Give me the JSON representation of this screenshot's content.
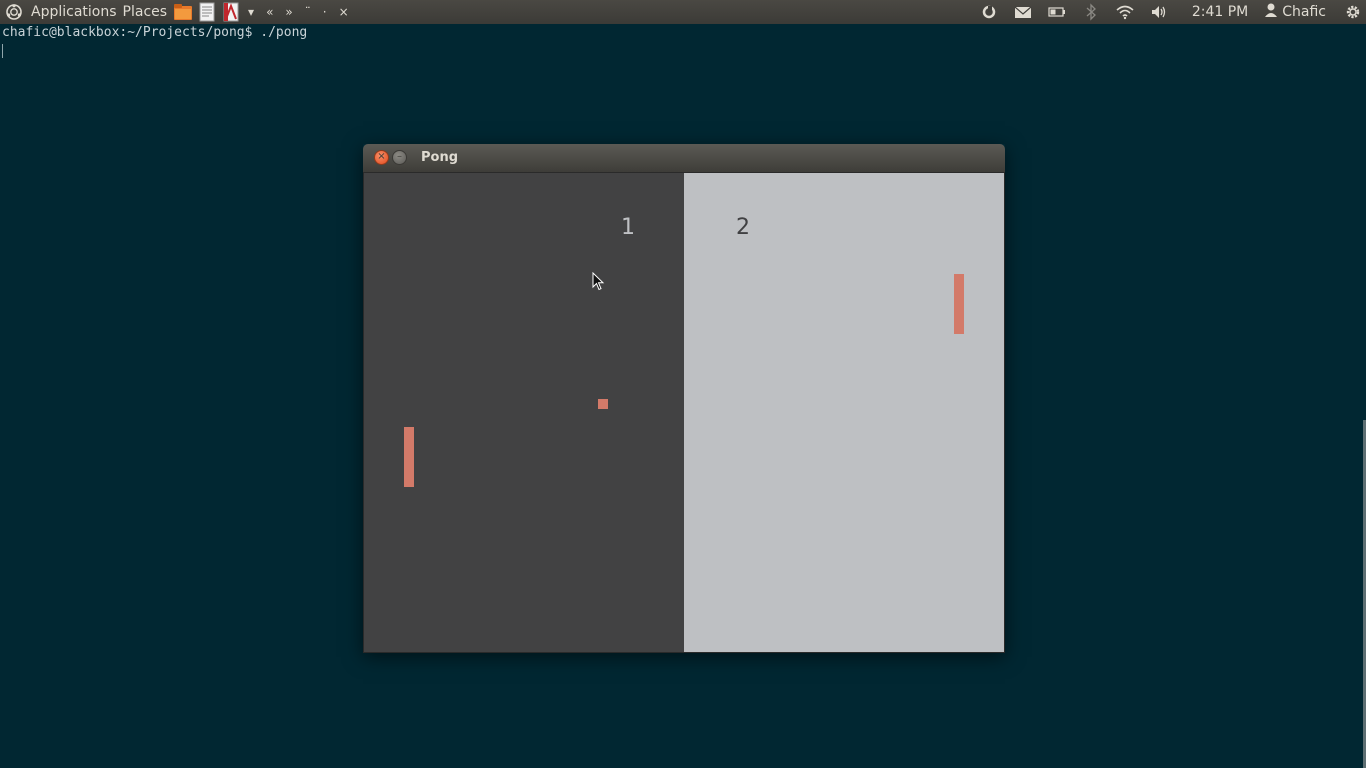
{
  "panel": {
    "menus": [
      "Applications",
      "Places"
    ],
    "nav_glyphs": [
      "«",
      "»",
      "¨",
      "·",
      "×"
    ],
    "clock": "2:41 PM",
    "user": "Chafic"
  },
  "terminal": {
    "prompt_line": "chafic@blackbox:~/Projects/pong$ ./pong"
  },
  "window": {
    "title": "Pong",
    "close_glyph": "×",
    "minimize_glyph": "–"
  },
  "game": {
    "score_left": "1",
    "score_right": "2",
    "colors": {
      "left_field": "#424243",
      "right_field": "#bec0c3",
      "paddle": "#d37a69",
      "ball": "#d37a69"
    }
  },
  "icons": {
    "launcher_1": "folder-icon",
    "launcher_2": "text-editor-icon",
    "launcher_3": "pdf-viewer-icon",
    "tray": [
      "network-icon",
      "mail-icon",
      "battery-icon",
      "bluetooth-icon",
      "wifi-icon",
      "volume-icon",
      "user-icon",
      "power-gear-icon"
    ]
  }
}
